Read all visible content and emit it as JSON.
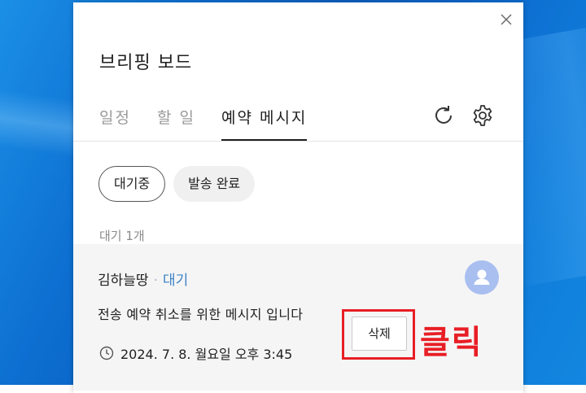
{
  "panel": {
    "title": "브리핑 보드"
  },
  "tabs": [
    {
      "label": "일정"
    },
    {
      "label": "할 일"
    },
    {
      "label": "예약 메시지"
    }
  ],
  "filters": {
    "waiting": "대기중",
    "sent": "발송 완료"
  },
  "list": {
    "count_label": "대기 1개"
  },
  "message": {
    "sender": "김하늘땅",
    "separator": "·",
    "status": "대기",
    "text": "전송 예약 취소를 위한 메시지 입니다",
    "time": "2024. 7. 8. 월요일 오후 3:45",
    "delete_label": "삭제"
  },
  "annotation": {
    "label": "클릭"
  },
  "colors": {
    "accent_red": "#e81e25",
    "status_blue": "#3b82c4",
    "avatar_bg": "#a9bff0"
  }
}
